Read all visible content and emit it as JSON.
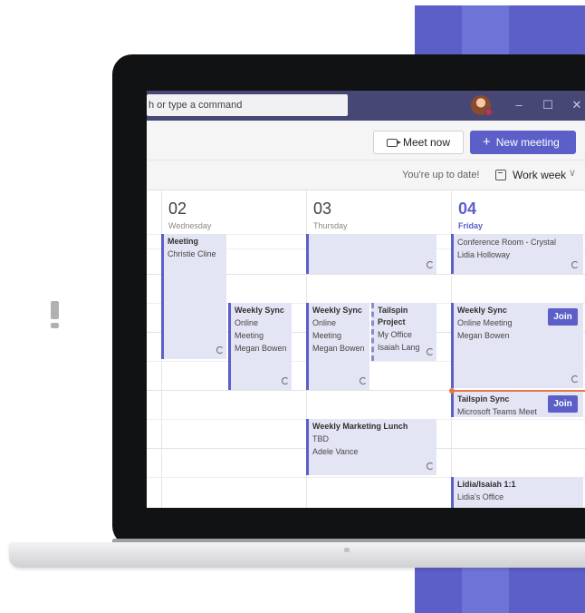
{
  "search": {
    "text": "h or type a command"
  },
  "window_controls": {
    "minimize": "–",
    "maximize": "☐",
    "close": "✕"
  },
  "toolbar": {
    "meet_now_label": "Meet now",
    "new_meeting_label": "New meeting",
    "plus_glyph": "+"
  },
  "status": {
    "text": "You're up to date!"
  },
  "view": {
    "label": "Work week",
    "chevron": "∨"
  },
  "days": [
    {
      "number": "02",
      "name": "Wednesday"
    },
    {
      "number": "03",
      "name": "Thursday"
    },
    {
      "number": "04",
      "name": "Friday"
    }
  ],
  "events": {
    "wed_meeting": {
      "title": "Meeting",
      "person": "Christie Cline"
    },
    "wed_weekly_sync": {
      "title": "Weekly Sync",
      "line1": "Online",
      "line2": "Meeting",
      "person": "Megan Bowen"
    },
    "thu_weekly_sync": {
      "title": "Weekly Sync",
      "line1": "Online",
      "line2": "Meeting",
      "person": "Megan Bowen"
    },
    "thu_tailspin": {
      "title1": "Tailspin",
      "title2": "Project",
      "location": "My Office",
      "person": "Isaiah Lang"
    },
    "thu_marketing_lunch": {
      "title": "Weekly Marketing Lunch",
      "location": "TBD",
      "person": "Adele Vance"
    },
    "fri_conference": {
      "location": "Conference Room - Crystal",
      "person": "Lidia Holloway"
    },
    "fri_weekly_sync": {
      "title": "Weekly Sync",
      "location": "Online Meeting",
      "person": "Megan Bowen",
      "join_label": "Join"
    },
    "fri_tailspin_sync": {
      "title": "Tailspin Sync",
      "location": "Microsoft Teams Meet",
      "join_label": "Join"
    },
    "fri_lidia_isaiah": {
      "title": "Lidia/Isaiah 1:1",
      "location": "Lidia's Office"
    }
  },
  "colors": {
    "brand": "#5b5fc7",
    "titlebar": "#464775",
    "event_fill": "#e3e4f4",
    "now_indicator": "#e97548"
  }
}
